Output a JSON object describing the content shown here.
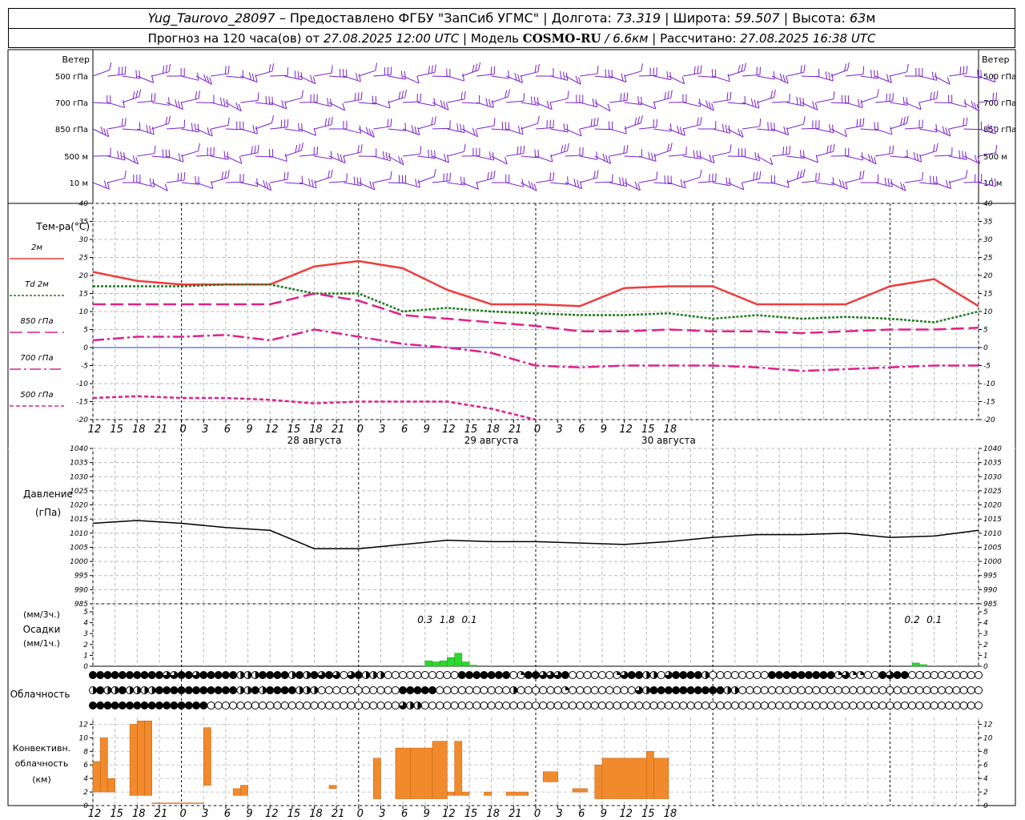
{
  "header": {
    "station": "Yug_Taurovo_28097",
    "provided_by": "– Предоставлено ФГБУ \"ЗапСиб УГМС\"",
    "lon_label": "Долгота:",
    "lon": "73.319",
    "lat_label": "Широта:",
    "lat": "59.507",
    "alt_label": "Высота:",
    "alt": "63",
    "alt_unit": "м",
    "forecast_prefix": "Прогноз на 120 часа(ов) от",
    "forecast_start": "27.08.2025 12:00 UTC",
    "model_label": "Модель",
    "model": "COSMO-RU",
    "model_res": "/ 6.6км",
    "calc_label": "Рассчитано:",
    "calc_time": "27.08.2025 16:38 UTC"
  },
  "chart_data": [
    {
      "type": "wind_barbs",
      "title": "Ветер",
      "levels": [
        "500 гПа",
        "700 гПа",
        "850 гПа",
        "500 м",
        "10 м"
      ],
      "color": "#7b1fd0"
    },
    {
      "type": "line",
      "title": "Тем-ра(°C)",
      "ylim": [
        -20,
        40
      ],
      "yticks": [
        -20,
        -15,
        -10,
        -5,
        0,
        5,
        10,
        15,
        20,
        25,
        30,
        35,
        40
      ],
      "x_hours": [
        0,
        6,
        12,
        18,
        24,
        30,
        36,
        42,
        48,
        54,
        60,
        66,
        72,
        78,
        84,
        90,
        96,
        102,
        108,
        114,
        120
      ],
      "series": [
        {
          "name": "2м",
          "color": "#f03c3c",
          "dash": "solid",
          "values": [
            21,
            18.5,
            17.5,
            17.5,
            17.5,
            22.5,
            24,
            22,
            16,
            12,
            12,
            11.5,
            16.5,
            17,
            17,
            12,
            12,
            12,
            17,
            19,
            11.5
          ]
        },
        {
          "name": "Td 2м",
          "color": "#1e7a1e",
          "dash": "dotted",
          "values": [
            17,
            17,
            17,
            17.5,
            17.5,
            15,
            15,
            10,
            11,
            10,
            9.5,
            9,
            9,
            9.5,
            8,
            9,
            8,
            8.5,
            8,
            7,
            10
          ]
        },
        {
          "name": "850 гПа",
          "color": "#e0208a",
          "dash": "longdash",
          "values": [
            12,
            12,
            12,
            12,
            12,
            15,
            13,
            9,
            8,
            7,
            6,
            4.5,
            4.5,
            5,
            4.5,
            4.5,
            4,
            4.5,
            5,
            5,
            5.5
          ]
        },
        {
          "name": "700 гПа",
          "color": "#e0208a",
          "dash": "dashdot",
          "values": [
            2,
            3,
            3,
            3.5,
            2,
            5,
            3,
            1,
            0,
            -1.5,
            -5,
            -5.5,
            -5,
            -5,
            -5,
            -5.5,
            -6.5,
            -6,
            -5.5,
            -5,
            -5
          ]
        },
        {
          "name": "500 гПа",
          "color": "#e0208a",
          "dash": "dashed",
          "values": [
            -14,
            -13.5,
            -14,
            -14,
            -14.5,
            -15.5,
            -15,
            -15,
            -15,
            -17,
            -20
          ]
        }
      ],
      "zero_line_color": "#2040d0"
    },
    {
      "type": "line",
      "title": "Давление",
      "ylabel": "(гПа)",
      "ylim": [
        985,
        1040
      ],
      "yticks": [
        985,
        990,
        995,
        1000,
        1005,
        1010,
        1015,
        1020,
        1025,
        1030,
        1035,
        1040
      ],
      "series": [
        {
          "name": "",
          "color": "#000000",
          "values": [
            1013.5,
            1014.5,
            1013.5,
            1012,
            1011,
            1004.5,
            1004.5,
            1006,
            1007.5,
            1007,
            1007,
            1006.5,
            1006,
            1007,
            1008.5,
            1009.5,
            1009.5,
            1010,
            1008.5,
            1009,
            1011
          ]
        }
      ]
    },
    {
      "type": "bar",
      "title": "Осадки",
      "ylabels": [
        "(мм/3ч.)",
        "(мм/1ч.)"
      ],
      "ylim": [
        0,
        5
      ],
      "yticks": [
        0,
        1,
        2,
        3,
        4,
        5
      ],
      "color": "#2ed82e",
      "bars": [
        {
          "hour": 45,
          "value": 0.5
        },
        {
          "hour": 46,
          "value": 0.4
        },
        {
          "hour": 47,
          "value": 0.5
        },
        {
          "hour": 48,
          "value": 0.8
        },
        {
          "hour": 49,
          "value": 1.2
        },
        {
          "hour": 50,
          "value": 0.4
        },
        {
          "hour": 51,
          "value": 0.1
        },
        {
          "hour": 111,
          "value": 0.3
        },
        {
          "hour": 112,
          "value": 0.15
        }
      ],
      "annotations": [
        {
          "hour": 45,
          "text": "0.3"
        },
        {
          "hour": 48,
          "text": "1.8"
        },
        {
          "hour": 51,
          "text": "0.1"
        },
        {
          "hour": 111,
          "text": "0.2"
        },
        {
          "hour": 114,
          "text": "0.1"
        }
      ]
    },
    {
      "type": "cloud_symbols",
      "title": "Облачность",
      "rows": 3,
      "legend": "0 = clear, 1 = quarter, 2 = half, 3 = three-quarter, 4 = overcast",
      "row1": "4444444444334434444422244442424343034222000000000044444440144333400000013442203444420000000044444444413110043440",
      "row2": "2422422224444444444422424444222000000000004444400000000002000000100000000032444444444422000000000000000",
      "row3": "4444444444444444000000000000000000000000003220000000000000000000000000000000000000000000000000000000000000000000000000"
    },
    {
      "type": "bar",
      "title": "Конвективн. облачность",
      "ylabel": "(км)",
      "ylim": [
        0,
        13
      ],
      "yticks": [
        0,
        2,
        4,
        6,
        8,
        10,
        12
      ],
      "color": "#f08a2c",
      "bars": [
        {
          "h0": 0,
          "h1": 1,
          "bottom": 2,
          "top": 6.5
        },
        {
          "h0": 1,
          "h1": 2,
          "bottom": 2,
          "top": 10
        },
        {
          "h0": 2,
          "h1": 3,
          "bottom": 2,
          "top": 4
        },
        {
          "h0": 5,
          "h1": 6,
          "bottom": 1.5,
          "top": 12
        },
        {
          "h0": 6,
          "h1": 7,
          "bottom": 1.5,
          "top": 12.5
        },
        {
          "h0": 7,
          "h1": 8,
          "bottom": 1.5,
          "top": 12.5
        },
        {
          "h0": 8,
          "h1": 15,
          "bottom": 0.3,
          "top": 0.4
        },
        {
          "h0": 15,
          "h1": 16,
          "bottom": 3,
          "top": 11.5
        },
        {
          "h0": 19,
          "h1": 20,
          "bottom": 1.5,
          "top": 2.5
        },
        {
          "h0": 20,
          "h1": 21,
          "bottom": 1.5,
          "top": 3
        },
        {
          "h0": 32,
          "h1": 33,
          "bottom": 2.5,
          "top": 3
        },
        {
          "h0": 38,
          "h1": 39,
          "bottom": 1,
          "top": 7
        },
        {
          "h0": 41,
          "h1": 43,
          "bottom": 1,
          "top": 8.5
        },
        {
          "h0": 43,
          "h1": 46,
          "bottom": 1,
          "top": 8.5
        },
        {
          "h0": 46,
          "h1": 48,
          "bottom": 1,
          "top": 9.5
        },
        {
          "h0": 48,
          "h1": 49,
          "bottom": 1.5,
          "top": 2
        },
        {
          "h0": 49,
          "h1": 50,
          "bottom": 1.5,
          "top": 9.5
        },
        {
          "h0": 50,
          "h1": 51,
          "bottom": 1.5,
          "top": 2
        },
        {
          "h0": 53,
          "h1": 54,
          "bottom": 1.5,
          "top": 2
        },
        {
          "h0": 56,
          "h1": 59,
          "bottom": 1.5,
          "top": 2
        },
        {
          "h0": 61,
          "h1": 63,
          "bottom": 3.5,
          "top": 5
        },
        {
          "h0": 65,
          "h1": 67,
          "bottom": 2,
          "top": 2.5
        },
        {
          "h0": 68,
          "h1": 69,
          "bottom": 1,
          "top": 6
        },
        {
          "h0": 69,
          "h1": 75,
          "bottom": 1,
          "top": 7
        },
        {
          "h0": 75,
          "h1": 76,
          "bottom": 1,
          "top": 8
        },
        {
          "h0": 76,
          "h1": 78,
          "bottom": 1,
          "top": 7
        }
      ]
    }
  ],
  "x_axis": {
    "tick_labels": [
      "12",
      "15",
      "18",
      "21",
      "0",
      "3",
      "6",
      "9",
      "12",
      "15",
      "18",
      "21",
      "0",
      "3",
      "6",
      "9",
      "12",
      "15",
      "18",
      "21",
      "0",
      "3",
      "6",
      "9",
      "12",
      "15",
      "18"
    ],
    "day_labels": [
      {
        "hour": 30,
        "text": "28 августа"
      },
      {
        "hour": 54,
        "text": "29 августа"
      },
      {
        "hour": 78,
        "text": "30 августа"
      }
    ]
  }
}
